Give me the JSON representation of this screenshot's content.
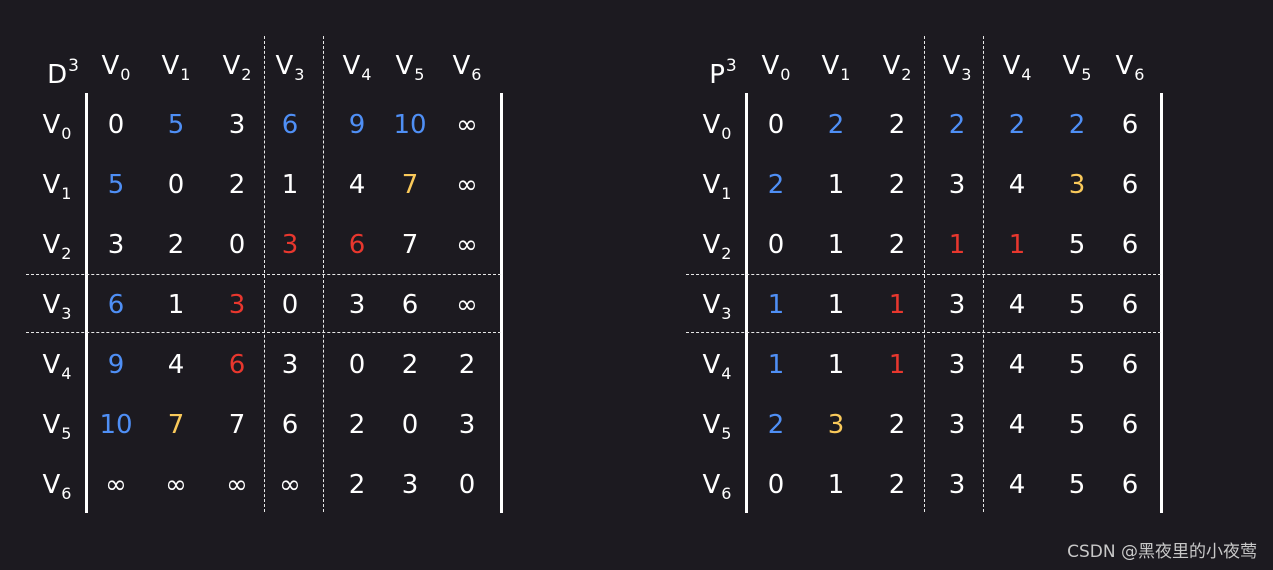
{
  "matrices": [
    {
      "id": "d",
      "letter": "D",
      "power": "3",
      "columns": [
        "V0",
        "V1",
        "V2",
        "V3",
        "V4",
        "V5",
        "V6"
      ],
      "rows": [
        "V0",
        "V1",
        "V2",
        "V3",
        "V4",
        "V5",
        "V6"
      ],
      "cells": [
        [
          [
            "0",
            "white"
          ],
          [
            "5",
            "blue"
          ],
          [
            "3",
            "white"
          ],
          [
            "6",
            "blue"
          ],
          [
            "9",
            "blue"
          ],
          [
            "10",
            "blue"
          ],
          [
            "∞",
            "white"
          ]
        ],
        [
          [
            "5",
            "blue"
          ],
          [
            "0",
            "white"
          ],
          [
            "2",
            "white"
          ],
          [
            "1",
            "white"
          ],
          [
            "4",
            "white"
          ],
          [
            "7",
            "yellow"
          ],
          [
            "∞",
            "white"
          ]
        ],
        [
          [
            "3",
            "white"
          ],
          [
            "2",
            "white"
          ],
          [
            "0",
            "white"
          ],
          [
            "3",
            "red"
          ],
          [
            "6",
            "red"
          ],
          [
            "7",
            "white"
          ],
          [
            "∞",
            "white"
          ]
        ],
        [
          [
            "6",
            "blue"
          ],
          [
            "1",
            "white"
          ],
          [
            "3",
            "red"
          ],
          [
            "0",
            "white"
          ],
          [
            "3",
            "white"
          ],
          [
            "6",
            "white"
          ],
          [
            "∞",
            "white"
          ]
        ],
        [
          [
            "9",
            "blue"
          ],
          [
            "4",
            "white"
          ],
          [
            "6",
            "red"
          ],
          [
            "3",
            "white"
          ],
          [
            "0",
            "white"
          ],
          [
            "2",
            "white"
          ],
          [
            "2",
            "white"
          ]
        ],
        [
          [
            "10",
            "blue"
          ],
          [
            "7",
            "yellow"
          ],
          [
            "7",
            "white"
          ],
          [
            "6",
            "white"
          ],
          [
            "2",
            "white"
          ],
          [
            "0",
            "white"
          ],
          [
            "3",
            "white"
          ]
        ],
        [
          [
            "∞",
            "white"
          ],
          [
            "∞",
            "white"
          ],
          [
            "∞",
            "white"
          ],
          [
            "∞",
            "white"
          ],
          [
            "2",
            "white"
          ],
          [
            "3",
            "white"
          ],
          [
            "0",
            "white"
          ]
        ]
      ]
    },
    {
      "id": "p",
      "letter": "P",
      "power": "3",
      "columns": [
        "V0",
        "V1",
        "V2",
        "V3",
        "V4",
        "V5",
        "V6"
      ],
      "rows": [
        "V0",
        "V1",
        "V2",
        "V3",
        "V4",
        "V5",
        "V6"
      ],
      "cells": [
        [
          [
            "0",
            "white"
          ],
          [
            "2",
            "blue"
          ],
          [
            "2",
            "white"
          ],
          [
            "2",
            "blue"
          ],
          [
            "2",
            "blue"
          ],
          [
            "2",
            "blue"
          ],
          [
            "6",
            "white"
          ]
        ],
        [
          [
            "2",
            "blue"
          ],
          [
            "1",
            "white"
          ],
          [
            "2",
            "white"
          ],
          [
            "3",
            "white"
          ],
          [
            "4",
            "white"
          ],
          [
            "3",
            "yellow"
          ],
          [
            "6",
            "white"
          ]
        ],
        [
          [
            "0",
            "white"
          ],
          [
            "1",
            "white"
          ],
          [
            "2",
            "white"
          ],
          [
            "1",
            "red"
          ],
          [
            "1",
            "red"
          ],
          [
            "5",
            "white"
          ],
          [
            "6",
            "white"
          ]
        ],
        [
          [
            "1",
            "blue"
          ],
          [
            "1",
            "white"
          ],
          [
            "1",
            "red"
          ],
          [
            "3",
            "white"
          ],
          [
            "4",
            "white"
          ],
          [
            "5",
            "white"
          ],
          [
            "6",
            "white"
          ]
        ],
        [
          [
            "1",
            "blue"
          ],
          [
            "1",
            "white"
          ],
          [
            "1",
            "red"
          ],
          [
            "3",
            "white"
          ],
          [
            "4",
            "white"
          ],
          [
            "5",
            "white"
          ],
          [
            "6",
            "white"
          ]
        ],
        [
          [
            "2",
            "blue"
          ],
          [
            "3",
            "yellow"
          ],
          [
            "2",
            "white"
          ],
          [
            "3",
            "white"
          ],
          [
            "4",
            "white"
          ],
          [
            "5",
            "white"
          ],
          [
            "6",
            "white"
          ]
        ],
        [
          [
            "0",
            "white"
          ],
          [
            "1",
            "white"
          ],
          [
            "2",
            "white"
          ],
          [
            "3",
            "white"
          ],
          [
            "4",
            "white"
          ],
          [
            "5",
            "white"
          ],
          [
            "6",
            "white"
          ]
        ]
      ]
    }
  ],
  "colors": {
    "white": "#ffffff",
    "blue": "#4f8ff5",
    "red": "#e8372e",
    "yellow": "#f9c95a"
  },
  "watermark": "CSDN @黑夜里的小夜莺"
}
